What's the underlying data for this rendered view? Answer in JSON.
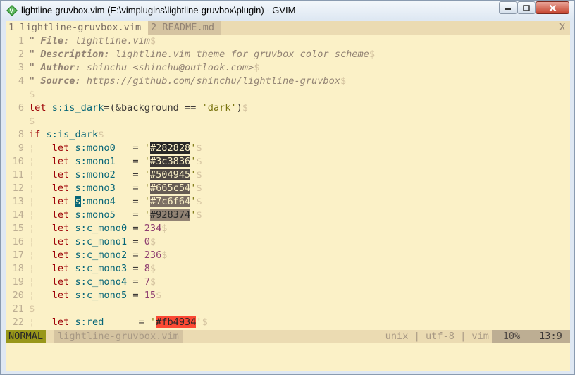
{
  "window": {
    "title": "lightline-gruvbox.vim (E:\\vimplugins\\lightline-gruvbox\\plugin) - GVIM",
    "minimize_glyph": "–",
    "maximize_glyph": "□",
    "close_glyph": "✕"
  },
  "tabline": {
    "tabs": [
      {
        "label": "1 lightline-gruvbox.vim"
      },
      {
        "label": "2 README.md"
      }
    ],
    "close_label": "X"
  },
  "lines": [
    {
      "n": "1"
    },
    {
      "n": "2"
    },
    {
      "n": "3"
    },
    {
      "n": "4"
    },
    {
      "n": ""
    },
    {
      "n": "6"
    },
    {
      "n": ""
    },
    {
      "n": "8"
    },
    {
      "n": "9"
    },
    {
      "n": "10"
    },
    {
      "n": "11"
    },
    {
      "n": "12"
    },
    {
      "n": "13"
    },
    {
      "n": "14"
    },
    {
      "n": "15"
    },
    {
      "n": "16"
    },
    {
      "n": "17"
    },
    {
      "n": "18"
    },
    {
      "n": "19"
    },
    {
      "n": "20"
    },
    {
      "n": "21"
    },
    {
      "n": "22"
    }
  ],
  "code": {
    "c1_key": "\" File:",
    "c1_val": " lightline.vim",
    "c2_key": "\" Description:",
    "c2_val": " lightline.vim theme for gruvbox color scheme",
    "c3_key": "\" Author:",
    "c3_val": " shinchu <shinchu@outlook.com>",
    "c4_key": "\" Source:",
    "c4_val": " https://github.com/shinchu/lightline-gruvbox",
    "eol": "$",
    "indent": "¦",
    "let": "let",
    "if": "if",
    "l6_var": "s:is_dark",
    "l6_rest": "=(&background == ",
    "l6_str": "'dark'",
    "l6_close": ")",
    "l8_var": "s:is_dark",
    "mono": [
      {
        "var": "s:mono0",
        "hex": "#282828",
        "color": "#282828",
        "text": "light"
      },
      {
        "var": "s:mono1",
        "hex": "#3c3836",
        "color": "#3c3836",
        "text": "light"
      },
      {
        "var": "s:mono2",
        "hex": "#504945",
        "color": "#504945",
        "text": "light"
      },
      {
        "var": "s:mono3",
        "hex": "#665c54",
        "color": "#665c54",
        "text": "light"
      },
      {
        "var": "s:mono4",
        "hex": "#7c6f64",
        "color": "#7c6f64",
        "text": "light"
      },
      {
        "var": "s:mono5",
        "hex": "#928374",
        "color": "#928374",
        "text": "dark"
      }
    ],
    "cmono": [
      {
        "var": "s:c_mono0",
        "val": "234"
      },
      {
        "var": "s:c_mono1",
        "val": "0"
      },
      {
        "var": "s:c_mono2",
        "val": "236"
      },
      {
        "var": "s:c_mono3",
        "val": "8"
      },
      {
        "var": "s:c_mono4",
        "val": "7"
      },
      {
        "var": "s:c_mono5",
        "val": "15"
      }
    ],
    "red_var": "s:red",
    "red_hex": "#fb4934",
    "red_color": "#fb4934"
  },
  "statusline": {
    "mode": "NORMAL",
    "filename": "lightline-gruvbox.vim",
    "fileformat": "unix | utf-8 | vim",
    "percent": "10%",
    "position": "13:9"
  }
}
